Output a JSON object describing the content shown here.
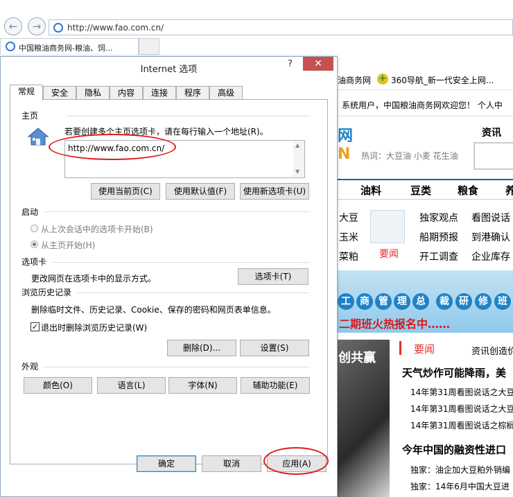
{
  "browser": {
    "address": "http://www.fao.com.cn/",
    "tab_title": "中国粮油商务网-粮油、饲..."
  },
  "site": {
    "fav_items": [
      "油商务网",
      "360导航_新一代安全上网..."
    ],
    "welcome": "系统用户，中国粮油商务网欢迎您！  个人中",
    "hot_label": "热词：大豆油  小麦  花生油",
    "logo_fragment_top": "网",
    "logo_fragment_bottom": "N",
    "news_tab": "资讯",
    "nav": [
      "油料",
      "豆类",
      "粮食",
      "养"
    ],
    "left_list": [
      "大豆",
      "玉米",
      "菜粕"
    ],
    "yaowen_icon_label": "要闻",
    "links_col1": [
      "独家观点",
      "船期预报",
      "开工调查"
    ],
    "links_col2": [
      "看图说话",
      "到港确认",
      "企业库存"
    ],
    "banner_chars": [
      "工",
      "商",
      "管",
      "理",
      "总",
      "裁",
      "研",
      "修",
      "班"
    ],
    "banner_sub": "二期班火热报名中……",
    "photo_text": "创共赢",
    "section_title": "要闻",
    "section_more": "资讯创造价",
    "headline1": "天气炒作可能降雨，美",
    "items1": [
      "14年第31周看图说话之大豆",
      "14年第31周看图说话之大豆",
      "14年第31周看图说话之棕榈"
    ],
    "headline2": "今年中国的融资性进口",
    "items2": [
      "独家：油企加大豆粕外销编",
      "独家：14年6月中国大豆进"
    ]
  },
  "dialog": {
    "title": "Internet 选项",
    "help": "?",
    "close": "✕",
    "tabs": [
      "常规",
      "安全",
      "隐私",
      "内容",
      "连接",
      "程序",
      "高级"
    ],
    "home": {
      "section": "主页",
      "desc": "若要创建多个主页选项卡，请在每行输入一个地址(R)。",
      "value": "http://www.fao.com.cn/",
      "btn_current": "使用当前页(C)",
      "btn_default": "使用默认值(F)",
      "btn_newtab": "使用新选项卡(U)"
    },
    "startup": {
      "section": "启动",
      "opt1": "从上次会话中的选项卡开始(B)",
      "opt2": "从主页开始(H)"
    },
    "tabsec": {
      "section": "选项卡",
      "desc": "更改网页在选项卡中的显示方式。",
      "btn": "选项卡(T)"
    },
    "history": {
      "section": "浏览历史记录",
      "desc": "删除临时文件、历史记录、Cookie、保存的密码和网页表单信息。",
      "checkbox": "退出时删除浏览历史记录(W)",
      "btn_delete": "删除(D)...",
      "btn_settings": "设置(S)"
    },
    "appearance": {
      "section": "外观",
      "btn_colors": "颜色(O)",
      "btn_lang": "语言(L)",
      "btn_fonts": "字体(N)",
      "btn_access": "辅助功能(E)"
    },
    "footer": {
      "ok": "确定",
      "cancel": "取消",
      "apply": "应用(A)"
    }
  },
  "colors": {
    "accent_red": "#e01818",
    "close_button": "#c75050",
    "site_blue": "#1e82c6"
  }
}
